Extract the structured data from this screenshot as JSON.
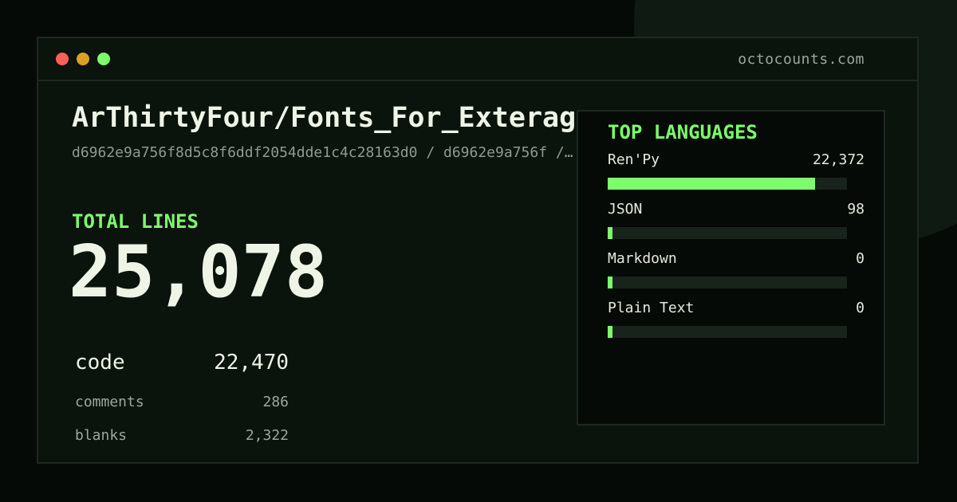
{
  "window": {
    "site": "octocounts.com"
  },
  "repo": {
    "title": "ArThirtyFour/Fonts_For_Exteragram",
    "subtitle": "d6962e9a756f8d5c8f6ddf2054dde1c4c28163d0 / d6962e9a756f /…"
  },
  "totals": {
    "label": "TOTAL LINES",
    "value": "25,078",
    "stats": [
      {
        "label": "code",
        "value": "22,470"
      },
      {
        "label": "comments",
        "value": "286"
      },
      {
        "label": "blanks",
        "value": "2,322"
      }
    ]
  },
  "languages": {
    "title": "TOP LANGUAGES",
    "items": [
      {
        "name": "Ren'Py",
        "count": "22,372",
        "share": 0.867
      },
      {
        "name": "JSON",
        "count": "98",
        "share": 0.004
      },
      {
        "name": "Markdown",
        "count": "0",
        "share": 0
      },
      {
        "name": "Plain Text",
        "count": "0",
        "share": 0
      }
    ]
  },
  "colors": {
    "accent": "#7cff6b",
    "background": "#060a07",
    "window": "#0b130d",
    "text": "#eef5e6",
    "muted": "#9aa79c",
    "dot_red": "#ff5f57",
    "dot_yellow": "#d9a026",
    "dot_green": "#7cff6b"
  }
}
